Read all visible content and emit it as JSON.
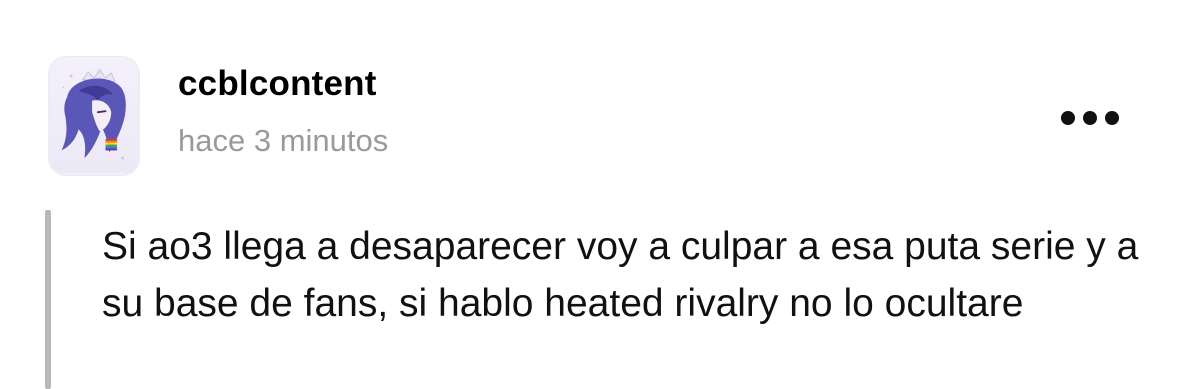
{
  "post": {
    "username": "ccblcontent",
    "timestamp": "hace 3 minutos",
    "avatar_icon": "anime-character-avatar",
    "more_icon": "more-horizontal-icon",
    "body_text": "Si ao3 llega a desaparecer voy a culpar a esa puta serie y a su base de fans, si hablo heated rivalry no lo ocultare"
  }
}
